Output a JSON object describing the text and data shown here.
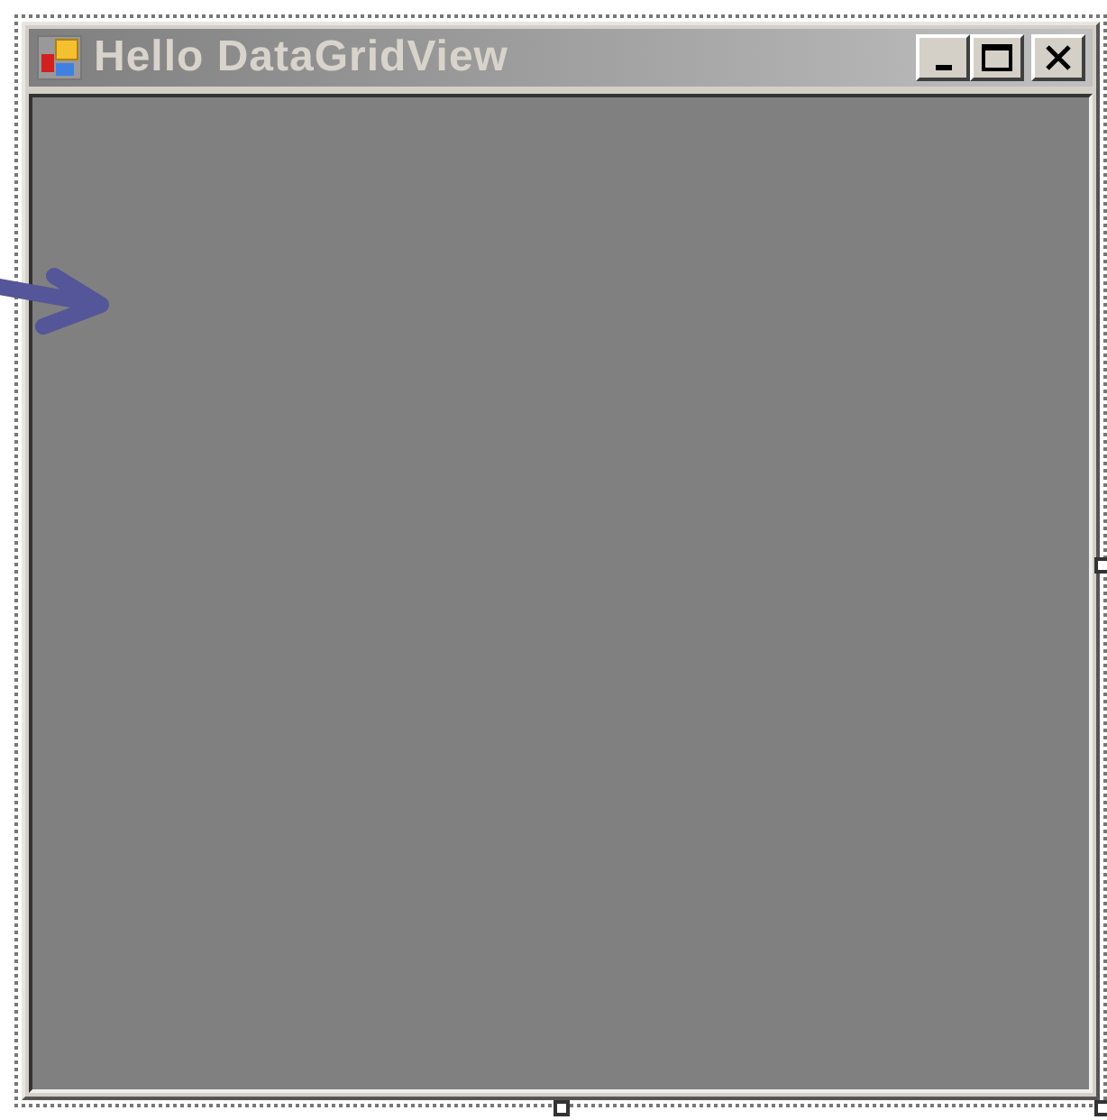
{
  "window": {
    "title": "Hello DataGridView"
  }
}
